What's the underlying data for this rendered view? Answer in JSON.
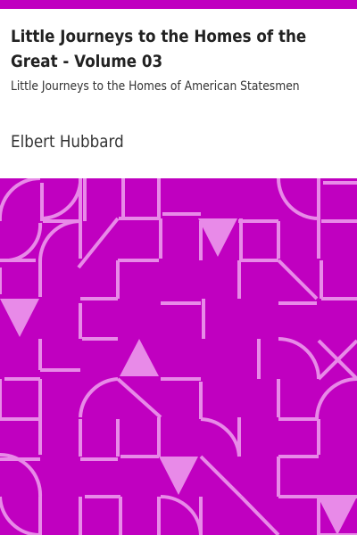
{
  "cover": {
    "title": "Little Journeys to the Homes of the Great - Volume 03",
    "subtitle": "Little Journeys to the Homes of American Statesmen",
    "author": "Elbert Hubbard"
  },
  "colors": {
    "accent": "#c000c0",
    "pattern_background": "#c000c0",
    "pattern_lines": "#e88ae8",
    "text": "#333333"
  }
}
